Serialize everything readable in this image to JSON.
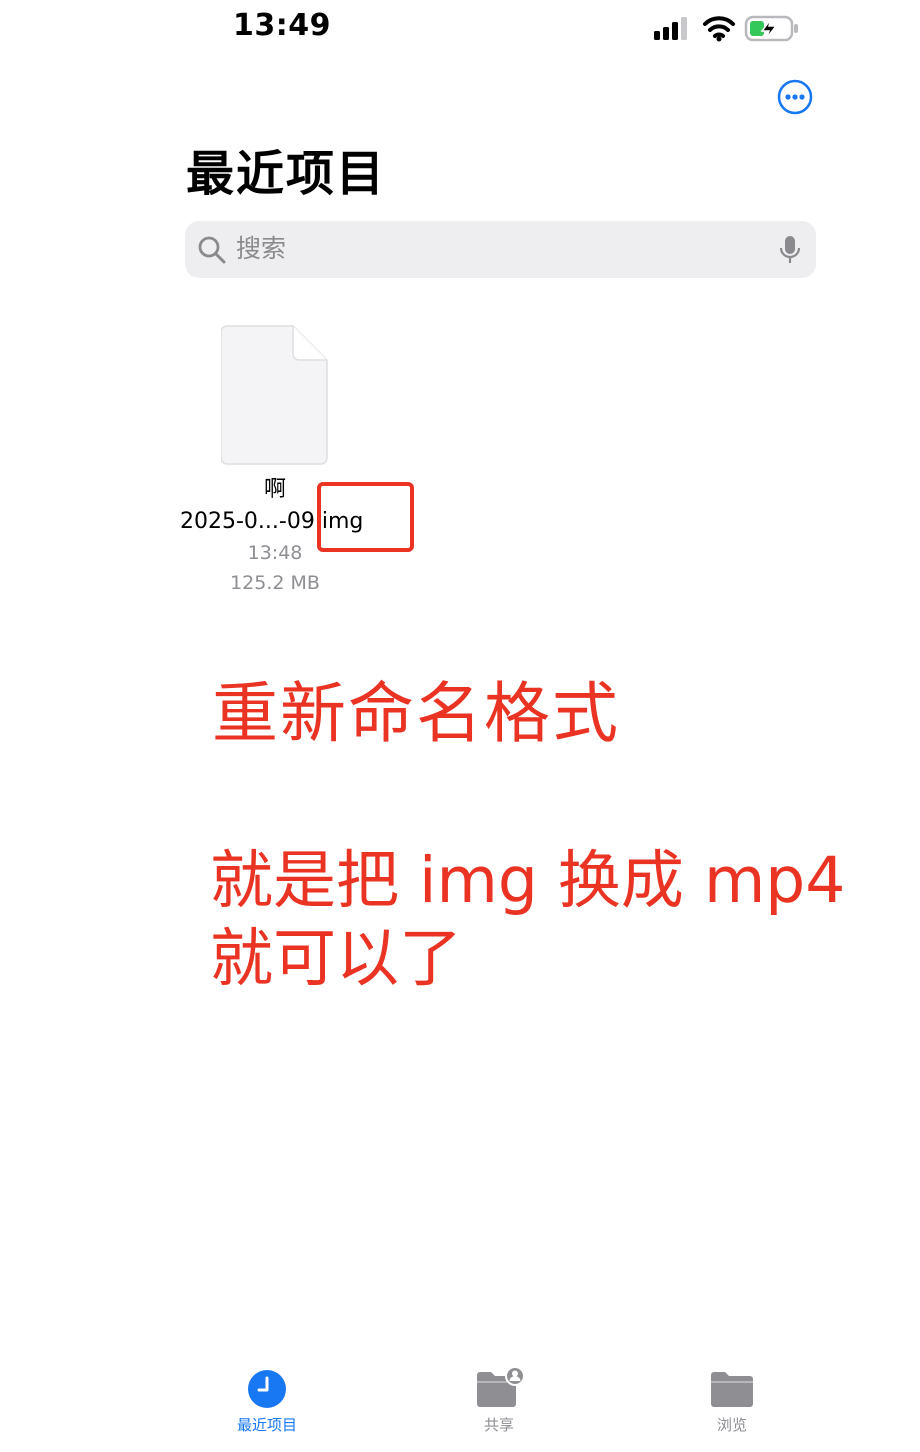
{
  "status_bar": {
    "time": "13:49"
  },
  "header": {
    "title": "最近项目"
  },
  "search": {
    "placeholder": "搜索"
  },
  "files": [
    {
      "name_line1": "啊",
      "name_line2": "2025-0...-09.img",
      "time": "13:48",
      "size": "125.2 MB"
    }
  ],
  "annotations": {
    "line1": "重新命名格式",
    "line2": "就是把 img 换成 mp4",
    "line3": "就可以了"
  },
  "tab_bar": {
    "tabs": [
      {
        "label": "最近项目",
        "icon": "clock-icon",
        "active": true
      },
      {
        "label": "共享",
        "icon": "shared-folder-icon",
        "active": false
      },
      {
        "label": "浏览",
        "icon": "folder-icon",
        "active": false
      }
    ]
  },
  "colors": {
    "accent": "#1877f2",
    "annotation": "#ea3323",
    "battery": "#34c759"
  }
}
